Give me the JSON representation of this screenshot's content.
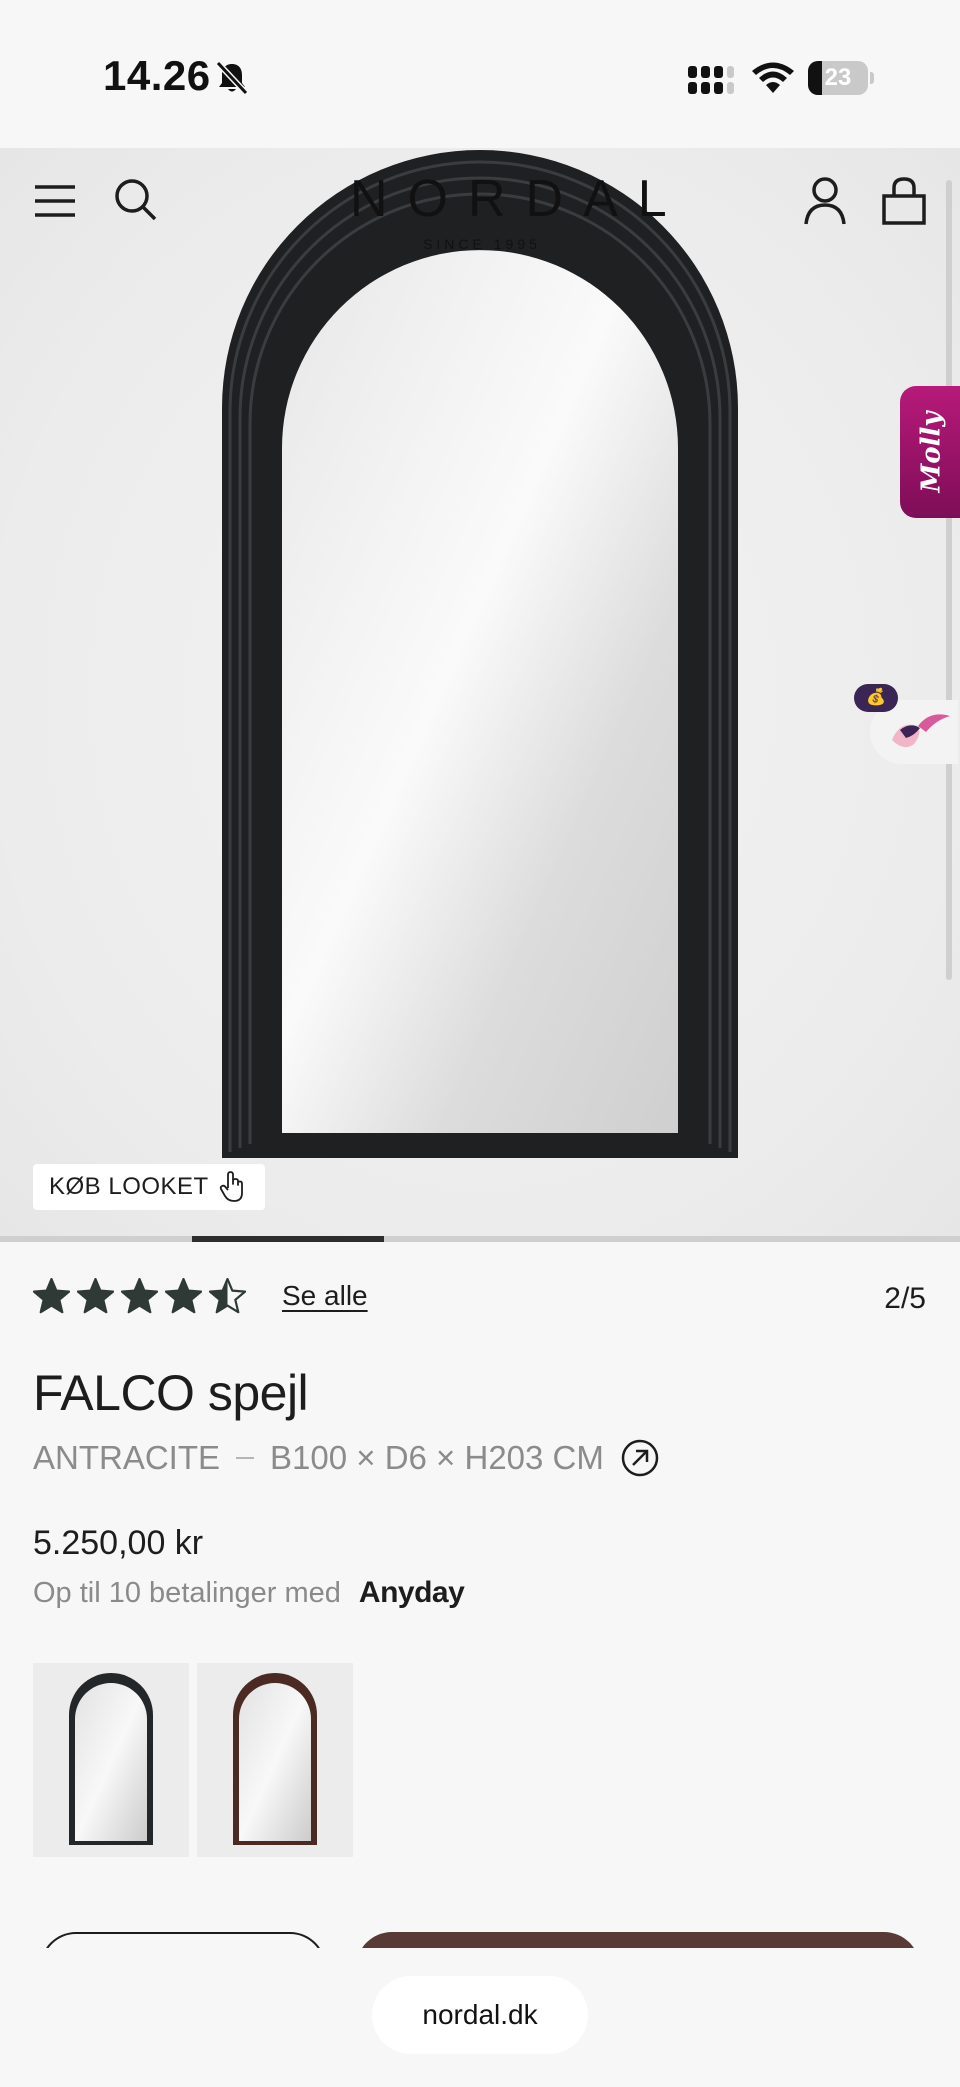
{
  "status_bar": {
    "time": "14.26",
    "battery_level": "23",
    "battery_fraction": 0.23,
    "icons": [
      "bell-muted-icon",
      "cellular-signal-icon",
      "wifi-icon",
      "battery-icon"
    ]
  },
  "header": {
    "logo": "NORDAL",
    "logo_tagline": "SINCE 1995",
    "icons": [
      "menu-icon",
      "search-icon",
      "account-icon",
      "cart-icon"
    ]
  },
  "gallery": {
    "shop_the_look_label": "KØB LOOKET",
    "current_index": 2,
    "total": 5,
    "progress_fraction": 0.4,
    "chat_tab_label": "Molly"
  },
  "rating": {
    "stars": 4.5,
    "max_stars": 5,
    "see_all_label": "Se alle",
    "counter": "2/5"
  },
  "product": {
    "name": "FALCO spejl",
    "color": "ANTRACITE",
    "dimensions": "B100 × D6 × H203 CM",
    "price": "5.250,00 kr",
    "installments_text": "Op til 10 betalinger med",
    "installments_provider": "Anyday"
  },
  "variants": [
    {
      "name": "Antracite",
      "frame_color": "#24272a"
    },
    {
      "name": "Brown",
      "frame_color": "#4a2a22"
    }
  ],
  "colors": {
    "accent_button": "#5a3a34",
    "star_fill": "#2f3a36",
    "molly_tab": "#a1156c"
  },
  "browser": {
    "url": "nordal.dk"
  }
}
